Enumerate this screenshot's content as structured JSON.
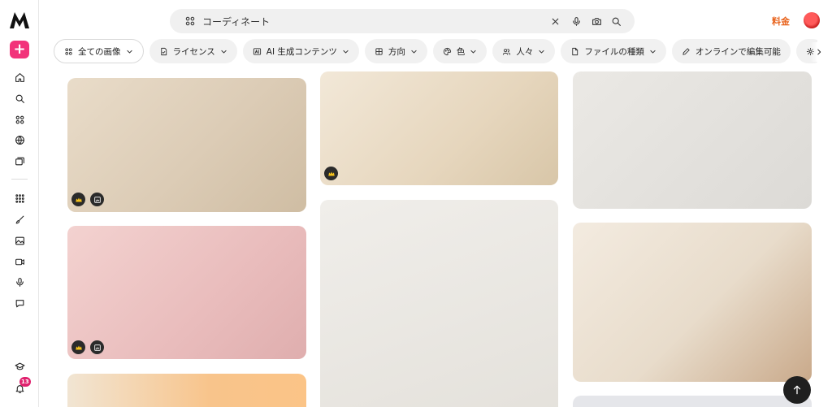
{
  "header": {
    "search": {
      "value": "コーディネート",
      "placeholder": "コーディネート"
    },
    "pricing_label": "料金"
  },
  "sidebar": {
    "create_label": "+",
    "notification_count": "13",
    "items": [
      "home-icon",
      "search-icon",
      "apps-icon",
      "globe-icon",
      "collections-icon",
      "grid-icon",
      "brush-icon",
      "image-icon",
      "video-icon",
      "mic-icon",
      "chat-icon",
      "graduation-icon",
      "bell-icon"
    ]
  },
  "filters": [
    {
      "label": "全ての画像",
      "icon": "apps-icon"
    },
    {
      "label": "ライセンス",
      "icon": "license-icon"
    },
    {
      "label": "AI 生成コンテンツ",
      "icon": "ai-icon"
    },
    {
      "label": "方向",
      "icon": "orientation-icon"
    },
    {
      "label": "色",
      "icon": "palette-icon"
    },
    {
      "label": "人々",
      "icon": "people-icon"
    },
    {
      "label": "ファイルの種類",
      "icon": "file-icon"
    },
    {
      "label": "オンラインで編集可能",
      "icon": "pen-icon"
    }
  ],
  "gallery": {
    "premium_badge_icon": "crown-icon",
    "ai_badge_icon": "ai-image-icon"
  },
  "colors": {
    "accent_pink": "#f2337a",
    "pricing_orange": "#e8621b",
    "badge_dark": "#2b2b2b"
  }
}
